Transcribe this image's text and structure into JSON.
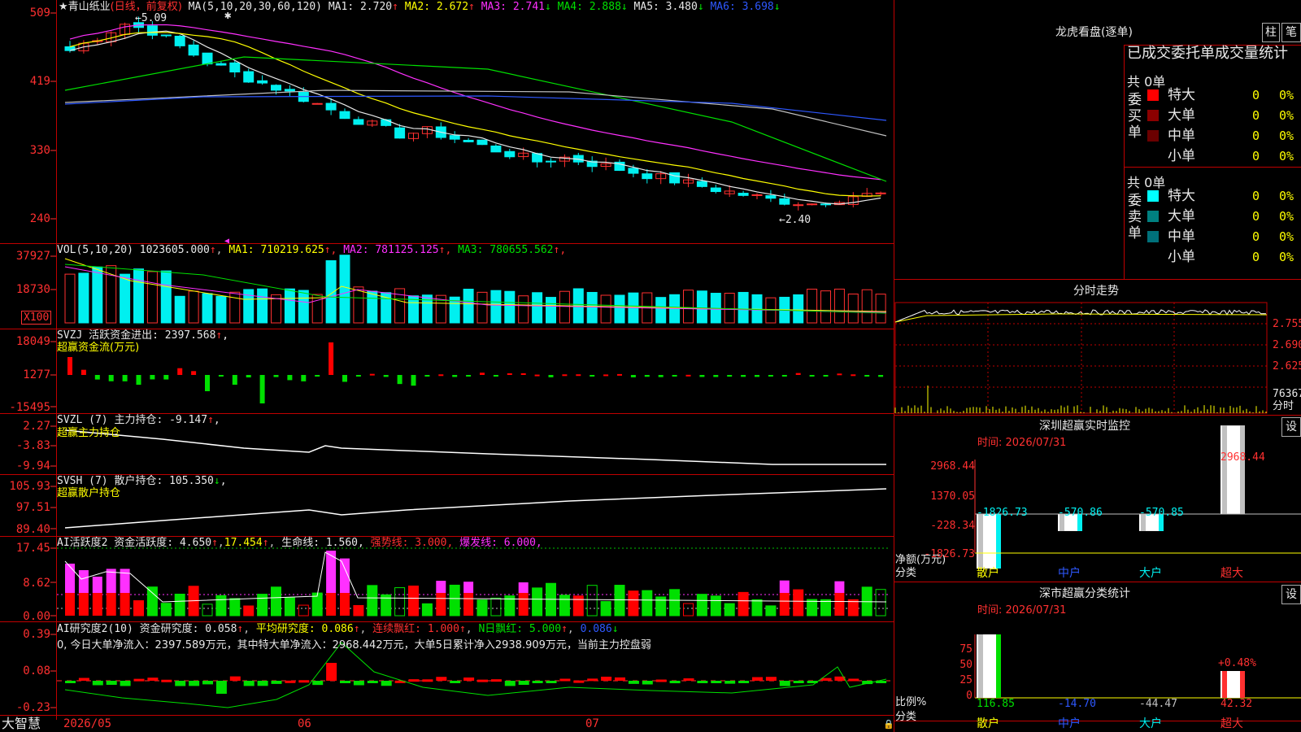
{
  "main": {
    "title": "★青山纸业",
    "period": "(日线，前复权)",
    "ma_label": "MA(5,10,20,30,60,120)",
    "ma": [
      {
        "text": "MA1: 2.720",
        "arrow": "↑",
        "color": "#e8e8e8",
        "arrow_color": "#ff3030"
      },
      {
        "text": "MA2: 2.672",
        "arrow": "↑",
        "color": "#ffff00",
        "arrow_color": "#ff3030"
      },
      {
        "text": "MA3: 2.741",
        "arrow": "↓",
        "color": "#ff30ff",
        "arrow_color": "#00e000"
      },
      {
        "text": "MA4: 2.888",
        "arrow": "↓",
        "color": "#00e000",
        "arrow_color": "#00e000"
      },
      {
        "text": "MA5: 3.480",
        "arrow": "↓",
        "color": "#e8e8e8",
        "arrow_color": "#00e000"
      },
      {
        "text": "MA6: 3.698",
        "arrow": "↓",
        "color": "#2e58ff",
        "arrow_color": "#00e000"
      }
    ],
    "axis": [
      "509",
      "419",
      "330",
      "240"
    ],
    "high_label": "←5.09",
    "low_label": "←2.40"
  },
  "vol": {
    "label": "VOL(5,10,20)",
    "value": "1023605.000",
    "ma": [
      {
        "text": "MA1: 710219.625",
        "color": "#ffff00"
      },
      {
        "text": "MA2: 781125.125",
        "color": "#ff30ff"
      },
      {
        "text": "MA3: 780655.562",
        "color": "#00e000"
      }
    ],
    "axis": [
      "37927",
      "18730"
    ],
    "unit": "X100"
  },
  "svzj": {
    "label": "SVZJ  活跃资金进出: 2397.568",
    "sub": "超赢资金流(万元)",
    "axis": [
      "18049",
      "1277",
      "-15495"
    ]
  },
  "svzl": {
    "label": "SVZL (7) 主力持仓: -9.147",
    "sub": "超赢主力持仓",
    "axis": [
      "2.27",
      "-3.83",
      "-9.94"
    ]
  },
  "svsh": {
    "label": "SVSH (7) 散户持仓: 105.350",
    "sub": "超赢散户持仓",
    "axis": [
      "105.93",
      "97.51",
      "89.40"
    ]
  },
  "ai1": {
    "label": "AI活跃度2 资金活跃度: 4.650",
    "v2": "17.454",
    "life": "生命线: 1.560,",
    "strong": "强势线: 3.000,",
    "burst": "爆发线: 6.000,",
    "axis": [
      "17.45",
      "8.62",
      "0.00"
    ]
  },
  "ai2": {
    "label": "AI研究度2(10) 资金研究度: 0.058",
    "avg": "平均研究度: 0.086",
    "cont": "连续飘红: 1.000",
    "nday": "N日飘红: 5.000",
    "last": "0.086",
    "summary": "0, 今日大单净流入：2397.589万元，其中特大单净流入：2968.442万元，大单5日累计净入2938.909万元，当前主力控盘弱",
    "axis": [
      "0.39",
      "0.08",
      "-0.23"
    ]
  },
  "bottom": {
    "brand": "大智慧",
    "dates": [
      "2026/05",
      "06",
      "07"
    ]
  },
  "lhkp": {
    "title": "龙虎看盘(逐单)",
    "btn1": "柱",
    "btn2": "笔",
    "sub": "已成交委托单成交量统计",
    "buy": {
      "side": "委买单",
      "total": "共 0单",
      "rows": [
        {
          "label": "特大",
          "count": "0",
          "pct": "0%",
          "color": "#ff0000"
        },
        {
          "label": "大单",
          "count": "0",
          "pct": "0%",
          "color": "#8b0000"
        },
        {
          "label": "中单",
          "count": "0",
          "pct": "0%",
          "color": "#6b0000"
        },
        {
          "label": "小单",
          "count": "0",
          "pct": "0%",
          "color": ""
        }
      ]
    },
    "sell": {
      "side": "委卖单",
      "total": "共 0单",
      "rows": [
        {
          "label": "特大",
          "count": "0",
          "pct": "0%",
          "color": "#00ffff"
        },
        {
          "label": "大单",
          "count": "0",
          "pct": "0%",
          "color": "#008080"
        },
        {
          "label": "中单",
          "count": "0",
          "pct": "0%",
          "color": "#00707a"
        },
        {
          "label": "小单",
          "count": "0",
          "pct": "0%",
          "color": ""
        }
      ]
    }
  },
  "intraday": {
    "title": "分时走势",
    "axis": [
      "2.755",
      "2.690",
      "2.625"
    ],
    "vol_label": "76367",
    "minute": "分时"
  },
  "szmon": {
    "title": "深圳超赢实时监控",
    "settings": "设",
    "time": "时间: 2026/07/31",
    "axis": [
      "2968.44",
      "1370.05",
      "-228.34",
      "-1826.73"
    ],
    "bars": [
      {
        "cat": "散户",
        "value": -1826.73,
        "label": "-1826.73"
      },
      {
        "cat": "中户",
        "value": -570.86,
        "label": "-570.86"
      },
      {
        "cat": "大户",
        "value": -570.85,
        "label": "-570.85"
      },
      {
        "cat": "超大",
        "value": 2968.44,
        "label": "2968.44"
      }
    ],
    "ylabel": "净额(万元)",
    "xlabel": "分类"
  },
  "szstat": {
    "title": "深市超赢分类统计",
    "settings": "设",
    "time": "时间: 2026/07/31",
    "axis": [
      "75",
      "50",
      "25",
      "0"
    ],
    "pct": "+0.48%",
    "bars": [
      {
        "cat": "散户",
        "label": "116.85"
      },
      {
        "cat": "中户",
        "label": "-14.70"
      },
      {
        "cat": "大户",
        "label": "-44.47"
      },
      {
        "cat": "超大",
        "label": "42.32"
      }
    ],
    "ylabel": "比例%",
    "xlabel": "分类"
  },
  "chart_data": {
    "type": "candlestick",
    "title": "青山纸业 (日线，前复权)",
    "ylim": [
      2.4,
      5.09
    ],
    "x_labels": [
      "2026/05",
      "06",
      "07"
    ],
    "ma_last": {
      "MA5": 2.72,
      "MA10": 2.672,
      "MA20": 2.741,
      "MA30": 2.888,
      "MA60": 3.48,
      "MA120": 3.698
    },
    "high": 5.09,
    "low": 2.4
  }
}
